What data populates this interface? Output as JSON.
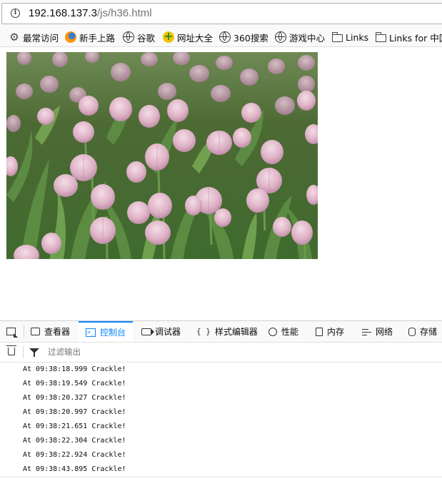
{
  "browser": {
    "url_host": "192.168.137.3",
    "url_path": "/js/h36.html"
  },
  "bookmarks": [
    {
      "label": "最常访问",
      "icon": "gear-icon"
    },
    {
      "label": "新手上路",
      "icon": "firefox-icon"
    },
    {
      "label": "谷歌",
      "icon": "globe-icon"
    },
    {
      "label": "网址大全",
      "icon": "plus-circle-icon"
    },
    {
      "label": "360搜索",
      "icon": "globe-icon"
    },
    {
      "label": "游戏中心",
      "icon": "globe-icon"
    },
    {
      "label": "Links",
      "icon": "folder-icon"
    },
    {
      "label": "Links for 中国",
      "icon": "folder-icon"
    }
  ],
  "devtools": {
    "tabs": [
      {
        "label": "查看器",
        "icon": "inspector-icon"
      },
      {
        "label": "控制台",
        "icon": "console-icon",
        "active": true
      },
      {
        "label": "调试器",
        "icon": "debugger-icon"
      },
      {
        "label": "样式编辑器",
        "icon": "style-editor-icon"
      },
      {
        "label": "性能",
        "icon": "performance-icon"
      },
      {
        "label": "内存",
        "icon": "memory-icon"
      },
      {
        "label": "网络",
        "icon": "network-icon"
      },
      {
        "label": "存储",
        "icon": "storage-icon"
      }
    ],
    "filter_placeholder": "过滤输出",
    "logs": [
      "At 09:38:18.999 Crackle!",
      "At 09:38:19.549 Crackle!",
      "At 09:38:20.327 Crackle!",
      "At 09:38:20.997 Crackle!",
      "At 09:38:21.651 Crackle!",
      "At 09:38:22.304 Crackle!",
      "At 09:38:22.924 Crackle!",
      "At 09:38:43.895 Crackle!"
    ]
  },
  "colors": {
    "accent": "#0a84ff",
    "toolbar_bg": "#f9f9fa"
  }
}
